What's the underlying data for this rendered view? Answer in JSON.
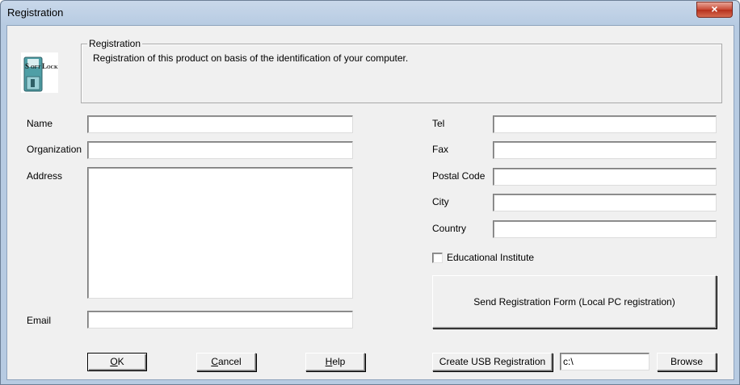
{
  "window": {
    "title": "Registration",
    "close_label": "×"
  },
  "logo": {
    "text_main": "SOFTLOCK",
    "icon": "softlock-floppy-logo"
  },
  "group": {
    "legend": "Registration",
    "description": "Registration of this product on basis of the identification of your computer."
  },
  "form": {
    "name_label": "Name",
    "organization_label": "Organization",
    "address_label": "Address",
    "email_label": "Email",
    "tel_label": "Tel",
    "fax_label": "Fax",
    "postal_code_label": "Postal Code",
    "city_label": "City",
    "country_label": "Country",
    "educational_label": "Educational Institute",
    "educational_checked": false,
    "values": {
      "name": "",
      "organization": "",
      "address": "",
      "email": "",
      "tel": "",
      "fax": "",
      "postal_code": "",
      "city": "",
      "country": ""
    }
  },
  "buttons": {
    "send_registration": "Send Registration Form (Local PC registration)",
    "ok_prefix": "",
    "ok_hotkey": "O",
    "ok_rest": "K",
    "cancel_prefix": "",
    "cancel_hotkey": "C",
    "cancel_rest": "ancel",
    "help_prefix": "",
    "help_hotkey": "H",
    "help_rest": "elp",
    "create_usb": "Create USB Registration",
    "browse": "Browse"
  },
  "usb_path": {
    "value": "c:\\"
  },
  "colors": {
    "dialog_bg": "#f0f0f0",
    "title_bg": "#c9d8ea",
    "close_red": "#c84a34"
  }
}
